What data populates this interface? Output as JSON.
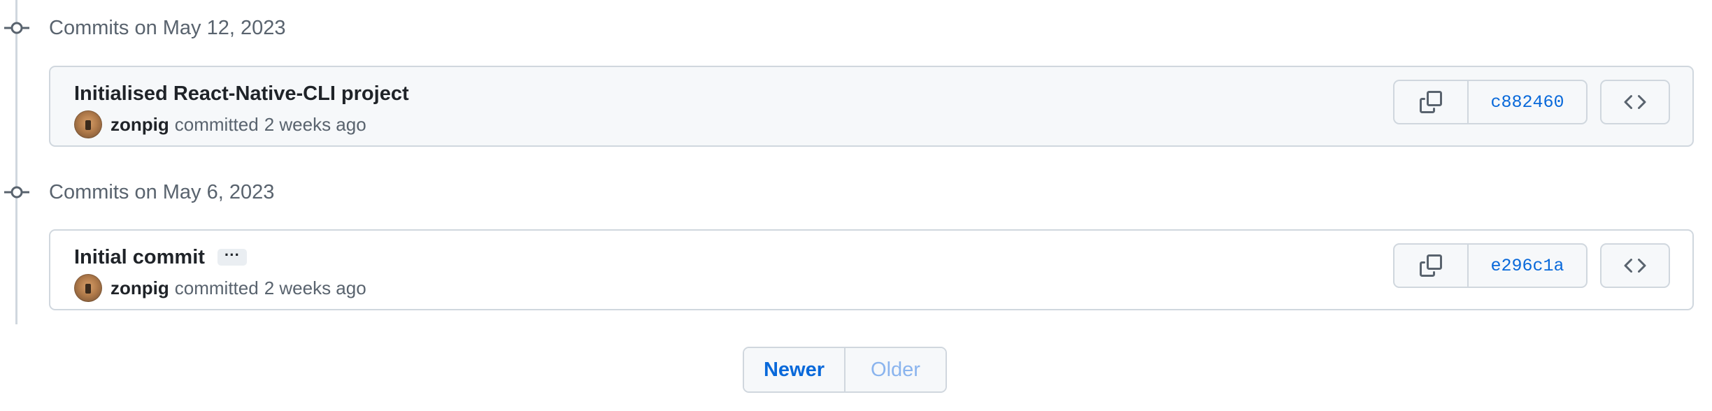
{
  "groups": [
    {
      "header": "Commits on May 12, 2023",
      "commit": {
        "title": "Initialised React-Native-CLI project",
        "author": "zonpig",
        "committed": "committed",
        "when": "2 weeks ago",
        "sha": "c882460",
        "has_ellipsis": false
      }
    },
    {
      "header": "Commits on May 6, 2023",
      "commit": {
        "title": "Initial commit",
        "author": "zonpig",
        "committed": "committed",
        "when": "2 weeks ago",
        "sha": "e296c1a",
        "has_ellipsis": true,
        "ellipsis_label": "···"
      }
    }
  ],
  "pagination": {
    "newer_label": "Newer",
    "older_label": "Older"
  },
  "icons": {
    "commit_node": "git-commit-icon",
    "copy": "copy-icon",
    "browse": "code-icon"
  },
  "colors": {
    "link": "#0969da",
    "muted_text": "#59636e",
    "border": "#d0d7de",
    "highlight_bg": "#f6f8fa"
  }
}
